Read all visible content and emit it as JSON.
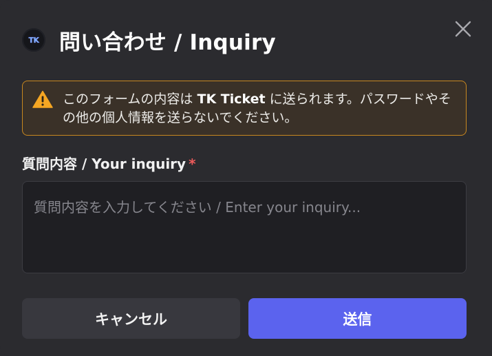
{
  "dialog": {
    "logo_text": "TK",
    "title": "問い合わせ / Inquiry"
  },
  "warning": {
    "text_before": "このフォームの内容は ",
    "brand": "TK Ticket",
    "text_after": " に送られます。パスワードやその他の個人情報を送らないでください。"
  },
  "form": {
    "label": "質問内容 / Your inquiry",
    "required_mark": "*",
    "placeholder": "質問内容を入力してください / Enter your inquiry..."
  },
  "buttons": {
    "cancel": "キャンセル",
    "submit": "送信"
  },
  "colors": {
    "background": "#2b2b2f",
    "warning_border": "#c9881f",
    "warning_icon": "#f5a623",
    "submit": "#5b63ee",
    "required": "#ef5b5b"
  },
  "icons": {
    "close": "close-icon",
    "warning": "warning-triangle-icon"
  }
}
